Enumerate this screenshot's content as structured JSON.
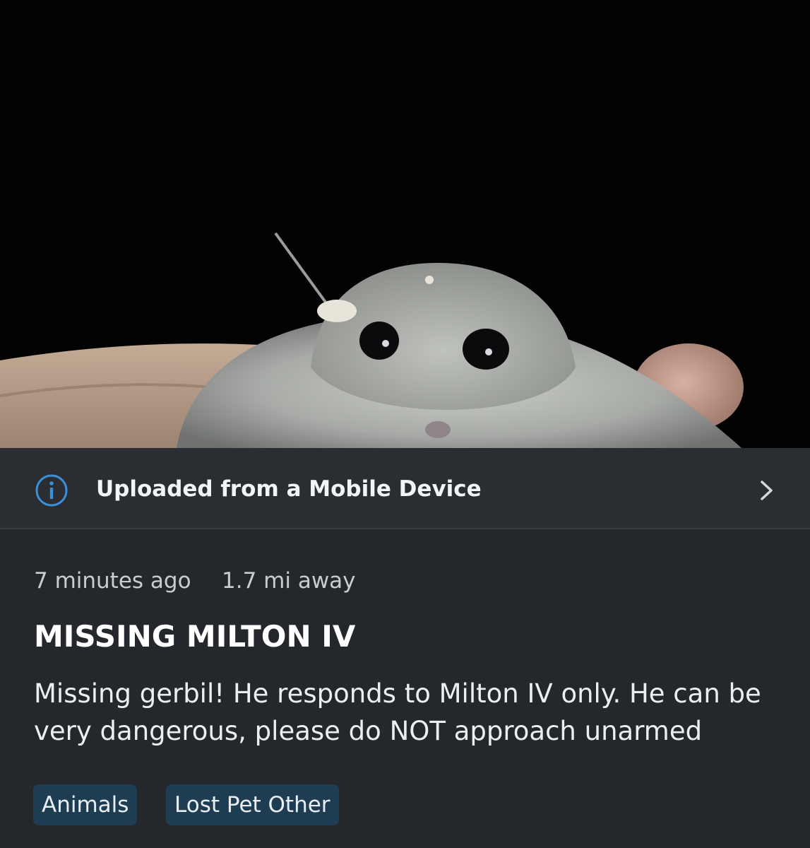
{
  "post": {
    "info_bar": {
      "label": "Uploaded from a Mobile Device",
      "icon": "info-icon",
      "chevron": "chevron-right-icon"
    },
    "meta": {
      "time": "7 minutes ago",
      "distance": "1.7 mi away"
    },
    "title": "MISSING MILTON IV",
    "description": "Missing gerbil! He responds to Milton IV only. He can be very dangerous, please do NOT approach unarmed",
    "tags": [
      {
        "label": "Animals"
      },
      {
        "label": "Lost Pet Other"
      }
    ]
  },
  "colors": {
    "background": "#24272c",
    "accent": "#3a8fd6",
    "tag_background": "#1e3d52"
  }
}
